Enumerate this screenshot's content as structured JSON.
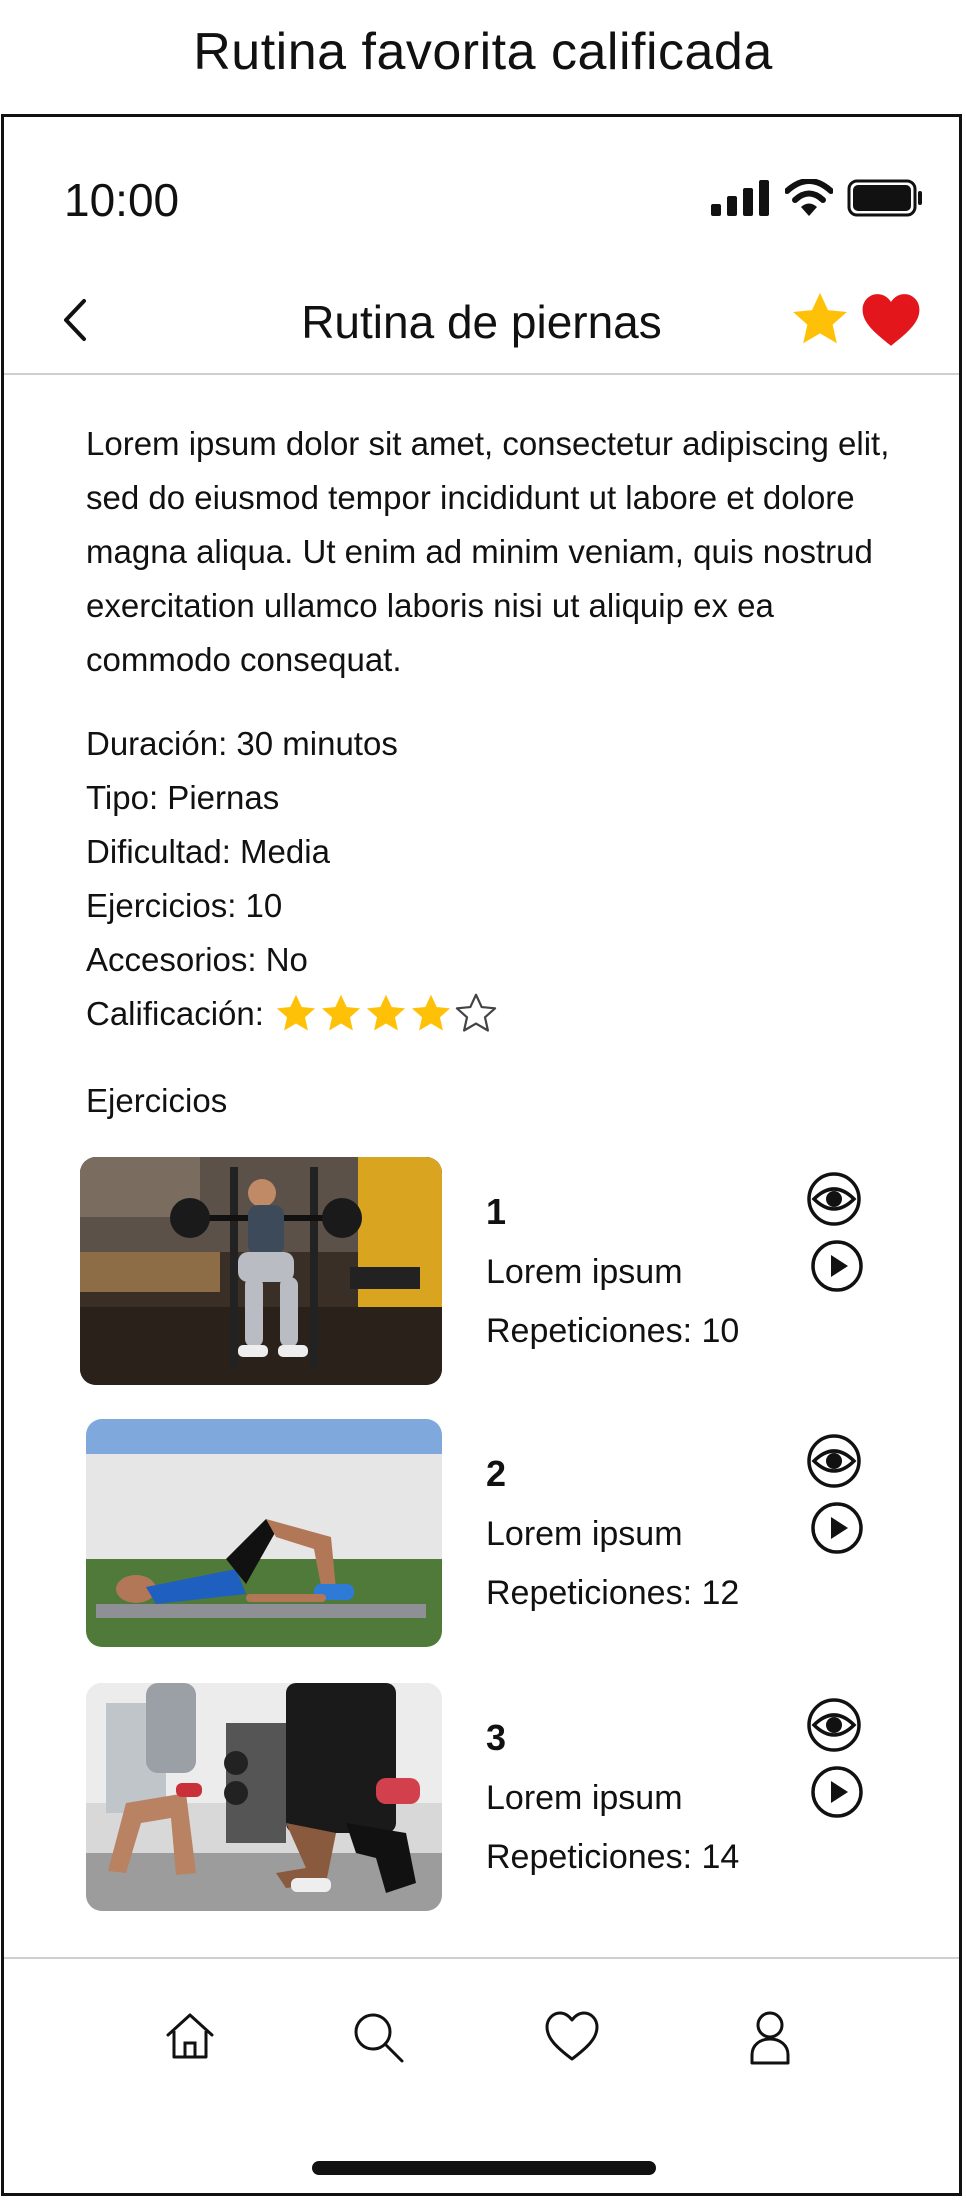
{
  "caption": "Rutina favorita calificada",
  "status_bar": {
    "time": "10:00"
  },
  "header": {
    "title": "Rutina de piernas",
    "favorite_star_color": "#FFC107",
    "favorite_heart_color": "#E3171B"
  },
  "routine": {
    "description": "Lorem ipsum dolor sit amet, consectetur adipiscing elit, sed do eiusmod tempor incididunt ut labore et dolore magna aliqua. Ut enim ad minim veniam, quis nostrud exercitation ullamco laboris nisi ut aliquip ex ea commodo consequat.",
    "duration": "Duración: 30 minutos",
    "type": "Tipo: Piernas",
    "difficulty": "Dificultad: Media",
    "exercises_count": "Ejercicios: 10",
    "accessories": "Accesorios: No",
    "rating_label": "Calificación:",
    "rating_value": 4,
    "rating_max": 5
  },
  "exercises_heading": "Ejercicios",
  "exercises": [
    {
      "number": "1",
      "name": "Lorem ipsum",
      "reps": "Repeticiones: 10"
    },
    {
      "number": "2",
      "name": "Lorem ipsum",
      "reps": "Repeticiones: 12"
    },
    {
      "number": "3",
      "name": "Lorem ipsum",
      "reps": "Repeticiones: 14"
    }
  ],
  "tabbar": {
    "icons": [
      "home-icon",
      "search-icon",
      "heart-icon",
      "profile-icon"
    ]
  }
}
